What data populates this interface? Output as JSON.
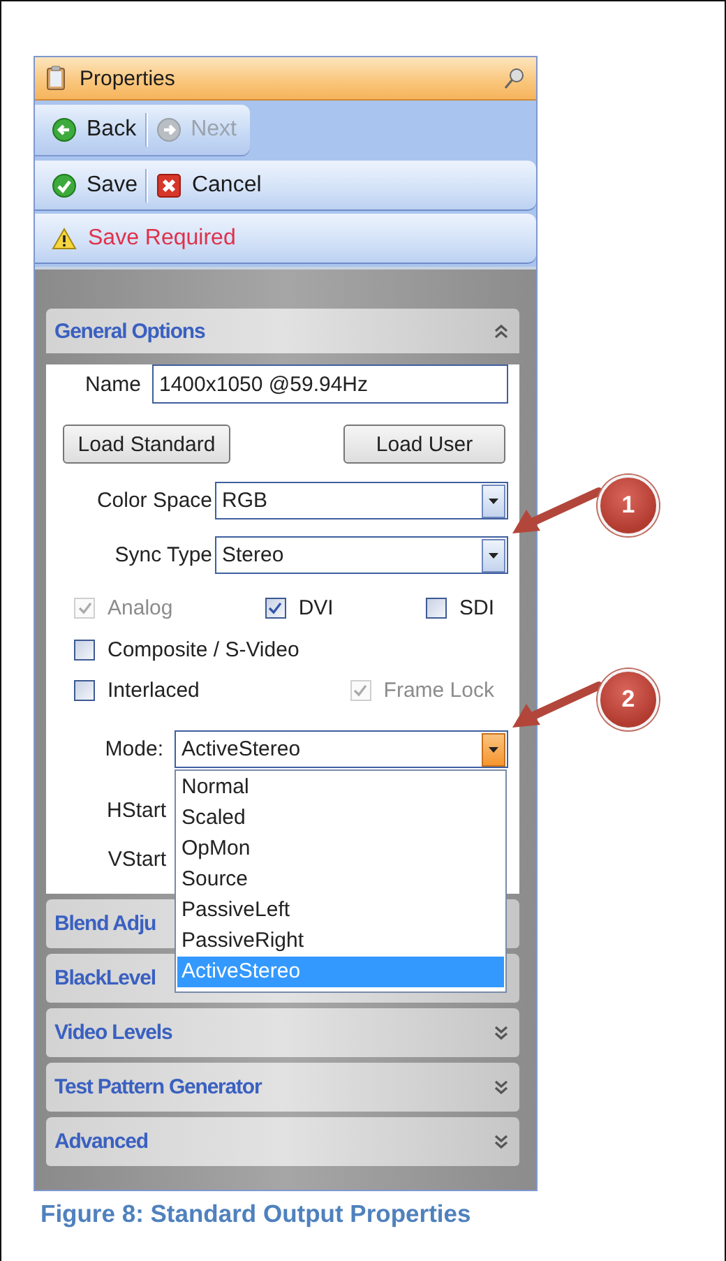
{
  "panel": {
    "title": "Properties"
  },
  "nav_buttons": [
    {
      "label": "Back",
      "disabled": false
    },
    {
      "label": "Next",
      "disabled": true
    }
  ],
  "action_buttons": [
    {
      "label": "Save",
      "kind": "save"
    },
    {
      "label": "Cancel",
      "kind": "cancel"
    }
  ],
  "warning": "Save Required",
  "sections": [
    {
      "title": "General Options",
      "expanded": true
    },
    {
      "title": "Blend Adju"
    },
    {
      "title": "BlackLevel"
    },
    {
      "title": "Video Levels",
      "expanded": false
    },
    {
      "title": "Test Pattern Generator",
      "expanded": false
    },
    {
      "title": "Advanced",
      "expanded": false
    }
  ],
  "general": {
    "name_label": "Name",
    "name_value": "1400x1050 @59.94Hz",
    "load_buttons": [
      "Load Standard",
      "Load User"
    ],
    "color_space": {
      "label": "Color Space",
      "value": "RGB"
    },
    "sync_type": {
      "label": "Sync Type",
      "value": "Stereo"
    },
    "checkbox_rows": [
      [
        {
          "label": "Analog",
          "checked": true,
          "disabled": true
        },
        {
          "label": "DVI",
          "checked": true,
          "disabled": false
        },
        {
          "label": "SDI",
          "checked": false,
          "disabled": false
        }
      ],
      [
        {
          "label": "Composite / S-Video",
          "checked": false,
          "disabled": false
        }
      ],
      [
        {
          "label": "Interlaced",
          "checked": false,
          "disabled": false
        },
        {
          "label": "Frame Lock",
          "checked": true,
          "disabled": true
        }
      ]
    ],
    "mode": {
      "label": "Mode:",
      "value": "ActiveStereo",
      "open": true,
      "options": [
        {
          "label": "Normal",
          "selected": false
        },
        {
          "label": "Scaled",
          "selected": false
        },
        {
          "label": "OpMon",
          "selected": false
        },
        {
          "label": "Source",
          "selected": false
        },
        {
          "label": "PassiveLeft",
          "selected": false
        },
        {
          "label": "PassiveRight",
          "selected": false
        },
        {
          "label": "ActiveStereo",
          "selected": true
        }
      ]
    },
    "hstart_label": "HStart",
    "vstart_label": "VStart"
  },
  "callouts": [
    {
      "number": "1"
    },
    {
      "number": "2"
    }
  ],
  "caption": "Figure 8: Standard Output Properties"
}
